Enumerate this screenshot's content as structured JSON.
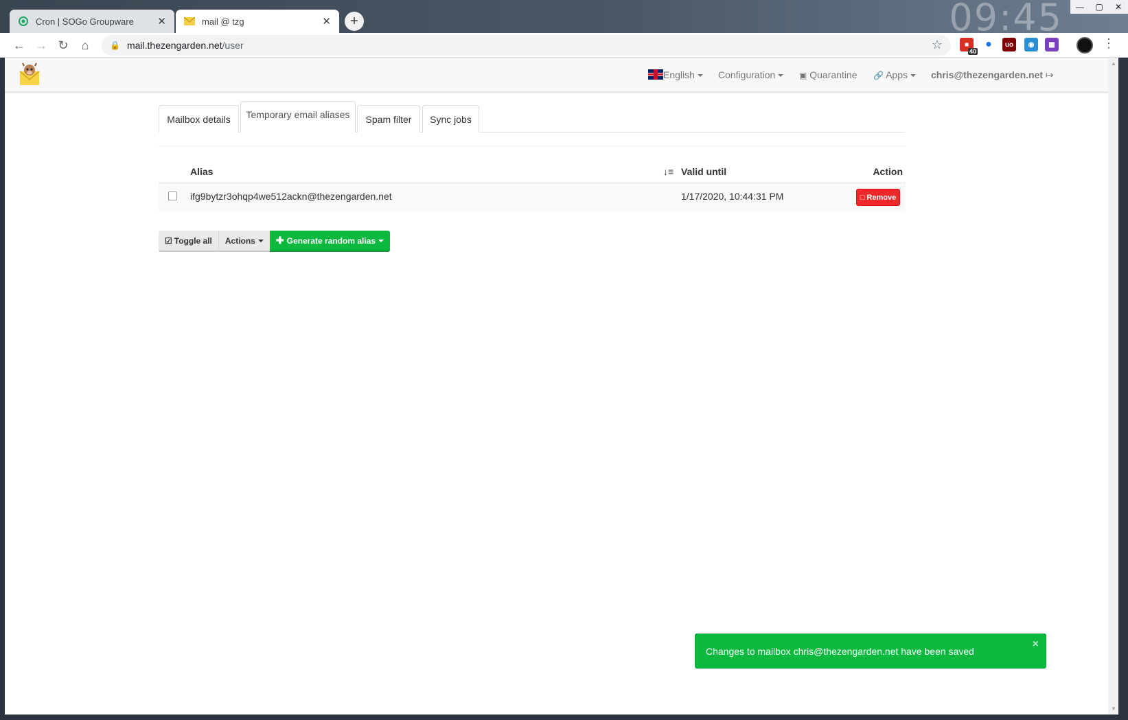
{
  "browser": {
    "tabs": [
      {
        "title": "Cron | SOGo Groupware",
        "icon": "sogo-icon",
        "active": false
      },
      {
        "title": "mail @ tzg",
        "icon": "envelope-icon",
        "active": true
      }
    ],
    "clock": "09:45",
    "url_host": "mail.thezengarden.net",
    "url_path": "/user",
    "extension_badge": "40"
  },
  "nav": {
    "language": "English",
    "configuration": "Configuration",
    "quarantine": "Quarantine",
    "apps": "Apps",
    "user": "chris@thezengarden.net"
  },
  "page_tabs": [
    {
      "label": "Mailbox details",
      "active": false
    },
    {
      "label": "Temporary email aliases",
      "active": true
    },
    {
      "label": "Spam filter",
      "active": false
    },
    {
      "label": "Sync jobs",
      "active": false
    }
  ],
  "table": {
    "headers": {
      "alias": "Alias",
      "valid_until": "Valid until",
      "action": "Action"
    },
    "rows": [
      {
        "alias": "ifg9bytzr3ohqp4we512ackn@thezengarden.net",
        "valid_until": "1/17/2020, 10:44:31 PM",
        "action": "Remove"
      }
    ]
  },
  "buttons": {
    "toggle_all": "Toggle all",
    "actions": "Actions",
    "generate": "Generate random alias"
  },
  "toast": {
    "message": "Changes to mailbox chris@thezengarden.net have been saved",
    "close": "×"
  },
  "colors": {
    "success": "#0db83e",
    "danger": "#ef2929"
  }
}
